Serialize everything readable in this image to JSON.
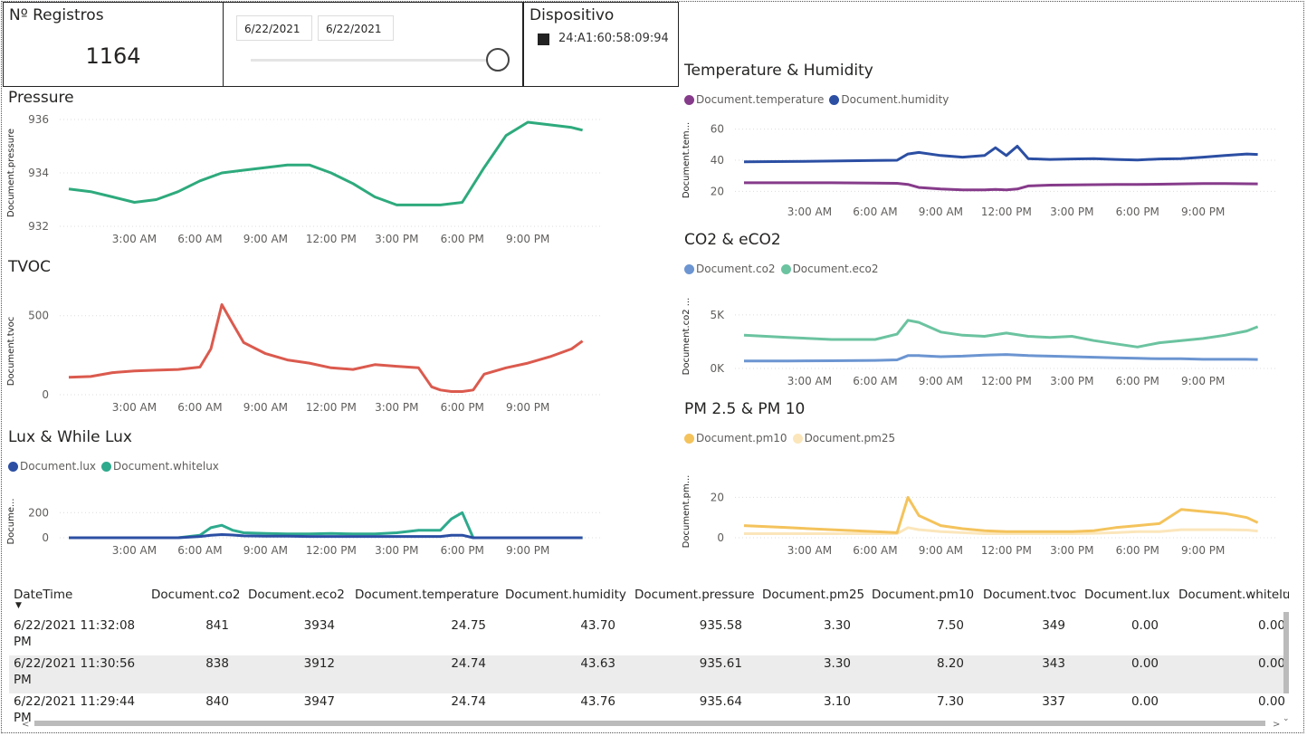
{
  "kpi": {
    "title": "Nº Registros",
    "value": "1164"
  },
  "date_slicer": {
    "start": "6/22/2021",
    "end": "6/22/2021"
  },
  "device_slicer": {
    "title": "Dispositivo",
    "item": "24:A1:60:58:09:94"
  },
  "x_ticks": [
    "3:00 AM",
    "6:00 AM",
    "9:00 AM",
    "12:00 PM",
    "3:00 PM",
    "6:00 PM",
    "9:00 PM"
  ],
  "colors": {
    "pressure": "#2eaa7d",
    "tvoc": "#db5a4e",
    "lux": "#2c4fa3",
    "whitelux": "#2eaa8d",
    "temperature": "#863b8a",
    "humidity": "#2c4fa3",
    "co2": "#6c95d1",
    "eco2": "#6bc3a0",
    "pm10": "#f4c35c",
    "pm25": "#fbe6bb"
  },
  "chart_data": [
    {
      "id": "pressure",
      "type": "line",
      "title": "Pressure",
      "ylabel": "Document.pressure",
      "yticks": [
        "932",
        "934",
        "936"
      ],
      "ylim": [
        932,
        936
      ],
      "x": [
        0,
        1,
        2,
        3,
        4,
        5,
        6,
        7,
        8,
        9,
        10,
        11,
        12,
        13,
        14,
        15,
        16,
        17,
        18,
        19,
        20,
        21,
        22,
        23,
        23.5
      ],
      "series": [
        {
          "name": "Document.pressure",
          "values": [
            933.4,
            933.3,
            933.1,
            932.9,
            933.0,
            933.3,
            933.7,
            934.0,
            934.1,
            934.2,
            934.3,
            934.3,
            934.0,
            933.6,
            933.1,
            932.8,
            932.8,
            932.8,
            932.9,
            934.2,
            935.4,
            935.9,
            935.8,
            935.7,
            935.6
          ]
        }
      ]
    },
    {
      "id": "tvoc",
      "type": "line",
      "title": "TVOC",
      "ylabel": "Document.tvoc",
      "yticks": [
        "0",
        "500"
      ],
      "ylim": [
        0,
        550
      ],
      "x": [
        0,
        1,
        2,
        3,
        4,
        5,
        6,
        6.5,
        7,
        7.5,
        8,
        9,
        10,
        11,
        12,
        13,
        14,
        15,
        16,
        16.6,
        17,
        17.5,
        18,
        18.5,
        19,
        20,
        21,
        22,
        23,
        23.5
      ],
      "series": [
        {
          "name": "Document.tvoc",
          "values": [
            110,
            115,
            140,
            150,
            155,
            160,
            175,
            290,
            570,
            450,
            330,
            260,
            220,
            200,
            170,
            160,
            190,
            180,
            170,
            50,
            30,
            20,
            20,
            30,
            130,
            170,
            200,
            240,
            290,
            340
          ]
        }
      ]
    },
    {
      "id": "lux",
      "type": "line",
      "title": "Lux & While Lux",
      "ylabel": "Docume...",
      "yticks": [
        "0",
        "200"
      ],
      "ylim": [
        0,
        260
      ],
      "x": [
        0,
        5,
        6,
        6.5,
        7,
        7.5,
        8,
        9,
        10,
        11,
        12,
        13,
        14,
        15,
        16,
        17,
        17.5,
        18,
        18.5,
        19,
        20,
        21,
        22,
        23,
        23.5
      ],
      "series": [
        {
          "name": "Document.lux",
          "values": [
            0,
            0,
            10,
            20,
            25,
            22,
            15,
            12,
            12,
            10,
            10,
            10,
            10,
            10,
            10,
            10,
            20,
            20,
            0,
            0,
            0,
            0,
            0,
            0,
            0
          ]
        },
        {
          "name": "Document.whitelux",
          "values": [
            0,
            0,
            20,
            80,
            100,
            60,
            40,
            35,
            30,
            30,
            35,
            30,
            30,
            40,
            60,
            60,
            150,
            200,
            0,
            0,
            0,
            0,
            0,
            0,
            0
          ]
        }
      ]
    },
    {
      "id": "temphum",
      "type": "line",
      "title": "Temperature & Humidity",
      "ylabel": "Document.tem...",
      "yticks": [
        "20",
        "40",
        "60"
      ],
      "ylim": [
        15,
        65
      ],
      "x": [
        0,
        2,
        4,
        6,
        7,
        7.5,
        8,
        9,
        10,
        11,
        11.5,
        12,
        12.5,
        13,
        14,
        15,
        16,
        17,
        18,
        19,
        20,
        21,
        22,
        23,
        23.5
      ],
      "series": [
        {
          "name": "Document.temperature",
          "values": [
            25.5,
            25.5,
            25.5,
            25.3,
            25.2,
            24.5,
            22.5,
            21.5,
            21,
            21,
            21.2,
            21,
            21.5,
            23.5,
            24,
            24.2,
            24.3,
            24.4,
            24.5,
            24.6,
            24.8,
            25,
            25,
            24.9,
            24.8
          ]
        },
        {
          "name": "Document.humidity",
          "values": [
            39,
            39.2,
            39.5,
            39.8,
            40,
            44,
            45,
            43,
            42,
            43,
            48,
            43,
            49,
            41,
            40.5,
            40.8,
            41,
            40.5,
            40.2,
            40.8,
            41,
            42,
            43,
            44,
            43.7
          ]
        }
      ]
    },
    {
      "id": "co2",
      "type": "line",
      "title": "CO2 & eCO2",
      "ylabel": "Document.co2 ...",
      "yticks": [
        "0K",
        "5K"
      ],
      "ylim": [
        0,
        6000
      ],
      "x": [
        0,
        2,
        4,
        6,
        7,
        7.5,
        8,
        9,
        10,
        11,
        12,
        13,
        14,
        15,
        16,
        17,
        18,
        19,
        20,
        21,
        22,
        23,
        23.5
      ],
      "series": [
        {
          "name": "Document.co2",
          "values": [
            700,
            700,
            720,
            750,
            800,
            1200,
            1200,
            1100,
            1150,
            1250,
            1300,
            1200,
            1150,
            1100,
            1050,
            1000,
            950,
            900,
            900,
            850,
            850,
            850,
            840
          ]
        },
        {
          "name": "Document.eco2",
          "values": [
            3100,
            2900,
            2700,
            2700,
            3200,
            4500,
            4300,
            3400,
            3100,
            3000,
            3300,
            3000,
            2900,
            3000,
            2600,
            2300,
            2000,
            2400,
            2600,
            2800,
            3100,
            3500,
            3900
          ]
        }
      ]
    },
    {
      "id": "pm",
      "type": "line",
      "title": "PM 2.5 & PM 10",
      "ylabel": "Document.pm...",
      "yticks": [
        "0",
        "20"
      ],
      "ylim": [
        0,
        26
      ],
      "x": [
        0,
        2,
        4,
        6,
        7,
        7.5,
        8,
        9,
        10,
        11,
        12,
        13,
        14,
        15,
        16,
        17,
        18,
        19,
        20,
        21,
        22,
        23,
        23.5
      ],
      "series": [
        {
          "name": "Document.pm10",
          "values": [
            6,
            5,
            4,
            3,
            2.5,
            20,
            11,
            6,
            4.5,
            3.5,
            3,
            3,
            3,
            3,
            3.5,
            5,
            6,
            7,
            14,
            13,
            12,
            10,
            7.5
          ]
        },
        {
          "name": "Document.pm25",
          "values": [
            2,
            2,
            2,
            2,
            2,
            5,
            4,
            3,
            2.5,
            2,
            2,
            2,
            2,
            2,
            2.2,
            2.5,
            3,
            3,
            4,
            4,
            4,
            3.8,
            3.3
          ]
        }
      ]
    }
  ],
  "table": {
    "columns": [
      "DateTime",
      "Document.co2",
      "Document.eco2",
      "Document.temperature",
      "Document.humidity",
      "Document.pressure",
      "Document.pm25",
      "Document.pm10",
      "Document.tvoc",
      "Document.lux",
      "Document.whitelux"
    ],
    "rows": [
      [
        "6/22/2021 11:32:08",
        "PM",
        "841",
        "3934",
        "24.75",
        "43.70",
        "935.58",
        "3.30",
        "7.50",
        "349",
        "0.00",
        "0.00"
      ],
      [
        "6/22/2021 11:30:56",
        "PM",
        "838",
        "3912",
        "24.74",
        "43.63",
        "935.61",
        "3.30",
        "8.20",
        "343",
        "0.00",
        "0.00"
      ],
      [
        "6/22/2021 11:29:44",
        "PM",
        "840",
        "3947",
        "24.74",
        "43.76",
        "935.64",
        "3.10",
        "7.30",
        "337",
        "0.00",
        "0.00"
      ]
    ]
  }
}
